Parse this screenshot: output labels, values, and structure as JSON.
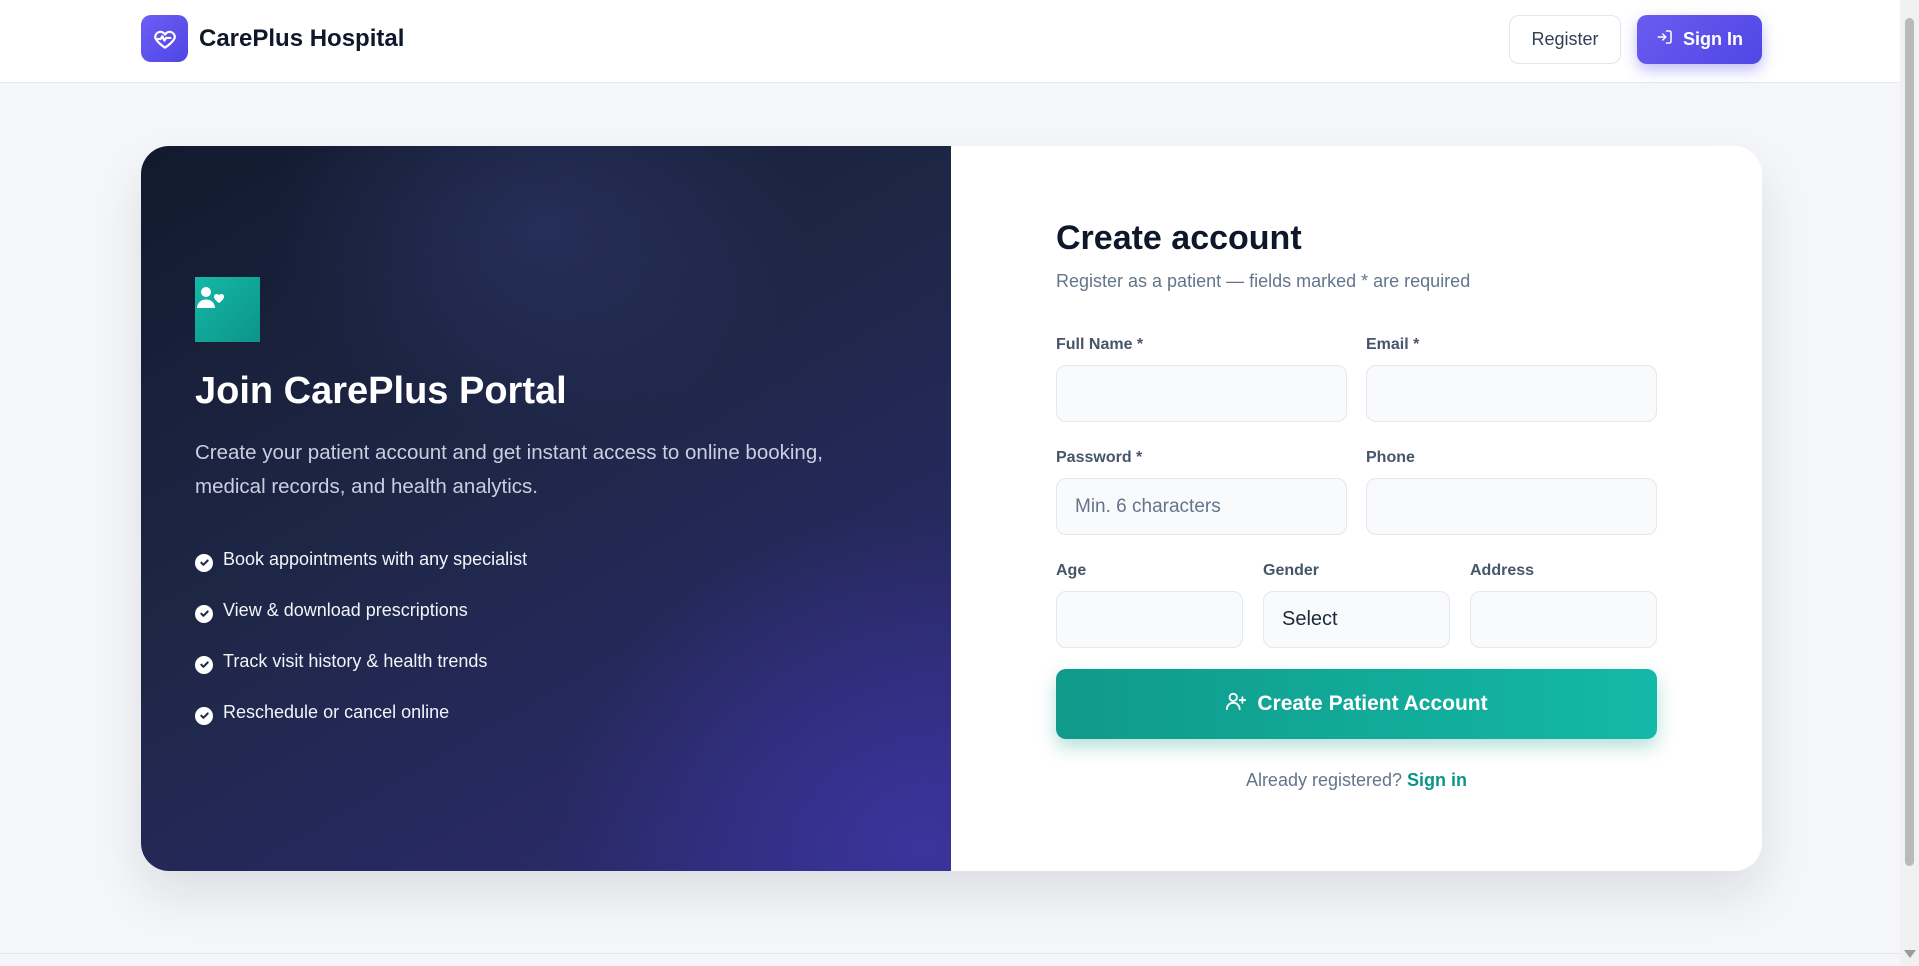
{
  "header": {
    "brand_name": "CarePlus Hospital",
    "logo_icon": "heart-pulse-icon",
    "register_label": "Register",
    "signin_label": "Sign In",
    "signin_icon": "login-icon"
  },
  "hero": {
    "icon": "user-heart-icon",
    "title": "Join CarePlus Portal",
    "description": "Create your patient account and get instant access to online booking, medical records, and health analytics.",
    "features": [
      "Book appointments with any specialist",
      "View & download prescriptions",
      "Track visit history & health trends",
      "Reschedule or cancel online"
    ]
  },
  "form": {
    "title": "Create account",
    "subtitle": "Register as a patient — fields marked * are required",
    "full_name": {
      "label": "Full Name *",
      "value": "",
      "placeholder": ""
    },
    "email": {
      "label": "Email *",
      "value": "",
      "placeholder": ""
    },
    "password": {
      "label": "Password *",
      "value": "",
      "placeholder": "Min. 6 characters"
    },
    "phone": {
      "label": "Phone",
      "value": "",
      "placeholder": ""
    },
    "age": {
      "label": "Age",
      "value": "",
      "placeholder": ""
    },
    "gender": {
      "label": "Gender",
      "selected": "Select"
    },
    "address": {
      "label": "Address",
      "value": "",
      "placeholder": ""
    },
    "submit_label": "Create Patient Account",
    "submit_icon": "user-plus-icon",
    "already_text": "Already registered?",
    "signin_link": "Sign in"
  },
  "colors": {
    "brand": "#5b4fe9",
    "accent": "#14b8a6",
    "hero_dark": "#121a2e",
    "text_dark": "#0f172a",
    "text_muted": "#64748b"
  }
}
